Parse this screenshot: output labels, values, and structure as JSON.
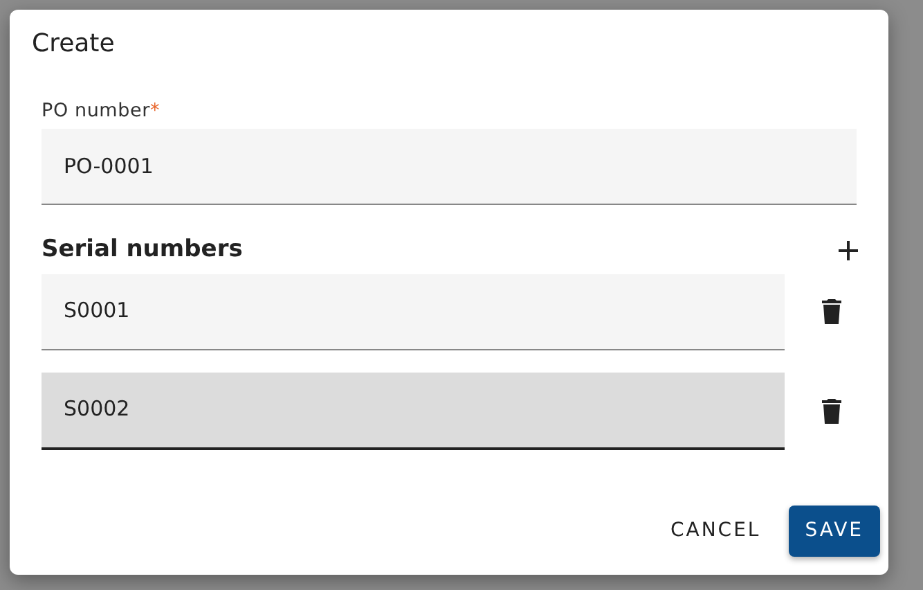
{
  "dialog": {
    "title": "Create"
  },
  "po_field": {
    "label": "PO number",
    "required_mark": "*",
    "value": "PO-0001"
  },
  "serial_section": {
    "title": "Serial numbers"
  },
  "serials": [
    {
      "value": "S0001",
      "focused": false
    },
    {
      "value": "S0002",
      "focused": true
    }
  ],
  "buttons": [
    {
      "label": "CANCEL",
      "kind": "text"
    },
    {
      "label": "SAVE",
      "kind": "primary"
    }
  ]
}
